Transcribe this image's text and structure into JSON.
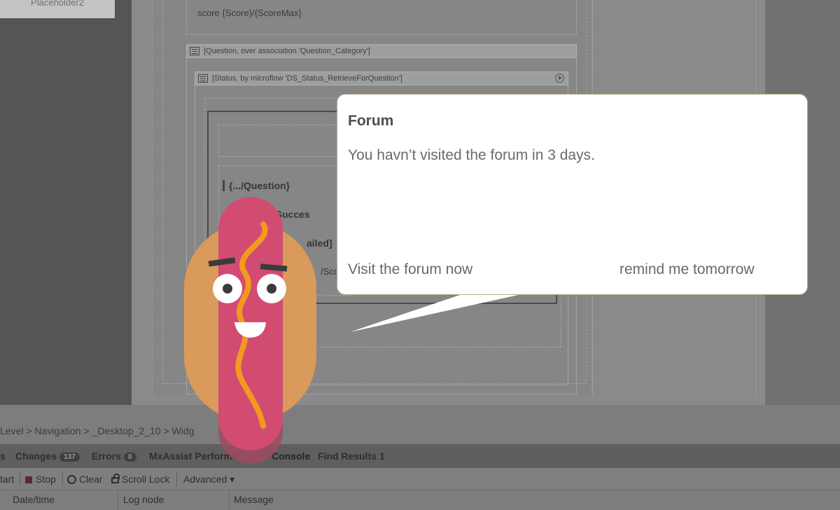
{
  "modeler": {
    "placeholder_label": "Placeholder2",
    "score_text": "score {Score}/{ScoreMax}",
    "question_dataview": "[Question, over association 'Question_Category']",
    "status_dataview": "[Status, by microflow 'DS_Status_RetrieveForQuestion']",
    "rows": [
      "{.../Question}",
      "tionSucces",
      "ailed]",
      "/Sco"
    ]
  },
  "breadcrumb": "Level > Navigation > _Desktop_2_10 > Widg",
  "tabs": [
    {
      "label": "s"
    },
    {
      "label": "Changes",
      "count": "137"
    },
    {
      "label": "Errors",
      "count": "0"
    },
    {
      "label": "MxAssist Performa"
    },
    {
      "label": "Console"
    },
    {
      "label": "Find Results 1"
    }
  ],
  "toolbar": {
    "start": "tart",
    "stop": "Stop",
    "clear": "Clear",
    "scroll_lock": "Scroll Lock",
    "advanced": "Advanced ▾"
  },
  "columns": [
    "Date/time",
    "Log node",
    "Message"
  ],
  "bubble": {
    "title": "Forum",
    "message": "You havn’t visited the forum in 3 days.",
    "primary": "Visit the forum now",
    "secondary": "remind me tomorrow"
  },
  "colors": {
    "bubble_bg": "#ffffff",
    "sausage": "#d24c72",
    "bun": "#d99a5b",
    "mustard": "#f39a1e"
  },
  "icons": [
    "dataview-icon",
    "run-icon",
    "stop-icon",
    "clear-icon",
    "lock-icon",
    "mascot-hotdog-icon"
  ]
}
